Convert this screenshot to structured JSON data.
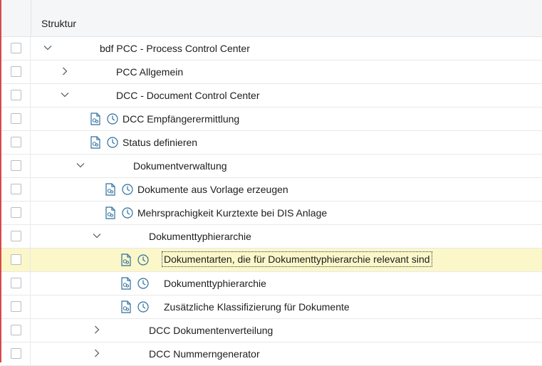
{
  "header": {
    "column_title": "Struktur"
  },
  "rows": [
    {
      "label": "bdf PCC - Process Control Center"
    },
    {
      "label": "PCC Allgemein"
    },
    {
      "label": "DCC - Document Control Center"
    },
    {
      "label": "DCC Empfängerermittlung"
    },
    {
      "label": "Status definieren"
    },
    {
      "label": "Dokumentverwaltung"
    },
    {
      "label": "Dokumente aus Vorlage erzeugen"
    },
    {
      "label": "Mehrsprachigkeit Kurztexte bei DIS Anlage"
    },
    {
      "label": "Dokumenttyphierarchie"
    },
    {
      "label": "Dokumentarten, die für Dokumenttyphierarchie relevant sind"
    },
    {
      "label": "Dokumenttyphierarchie"
    },
    {
      "label": "Zusätzliche Klassifizierung für Dokumente"
    },
    {
      "label": "DCC Dokumentenverteilung"
    },
    {
      "label": "DCC Nummerngenerator"
    }
  ],
  "icons": {
    "node_collapsed": "chevron-right-icon",
    "node_expanded": "chevron-down-icon",
    "activity": "document-icon",
    "history": "clock-icon"
  },
  "colors": {
    "selected_row": "#fbf7c9",
    "frame_accent": "#d64a4a",
    "icon": "#2e6f9e"
  }
}
